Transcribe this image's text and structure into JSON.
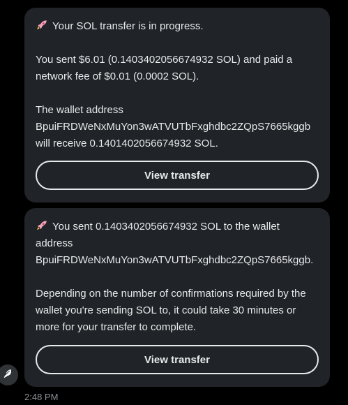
{
  "messages": [
    {
      "lines": [
        "Your SOL transfer is in progress.",
        "",
        "You sent $6.01 (0.1403402056674932 SOL) and paid a",
        "network fee of $0.01 (0.0002 SOL).",
        "",
        "The wallet address",
        "BpuiFRDWeNxMuYon3wATVUTbFxghdbc2ZQpS7665kggb",
        "will receive 0.140140205667493 2 SOL."
      ],
      "button_label": "View transfer"
    },
    {
      "lines": [
        "You sent  0.1403402056674932 SOL to the wallet",
        "address",
        "BpuiFRDWeNxMuYon3wATVUTbFxghdbc2ZQpS7665kggb.",
        "",
        "Depending on the number of confirmations required by the",
        "wallet you're sending SOL to, it could take 30 minutes or",
        "more for your transfer to complete."
      ],
      "button_label": "View transfer"
    }
  ],
  "timestamp": "2:48 PM",
  "icons": {
    "message_icon": "rocket-icon",
    "avatar_icon": "feather-icon"
  },
  "colors": {
    "background": "#000000",
    "bubble": "#202327",
    "text": "#e7e9ea",
    "muted": "#8b8f94",
    "rocket": "#f4a6b8"
  }
}
